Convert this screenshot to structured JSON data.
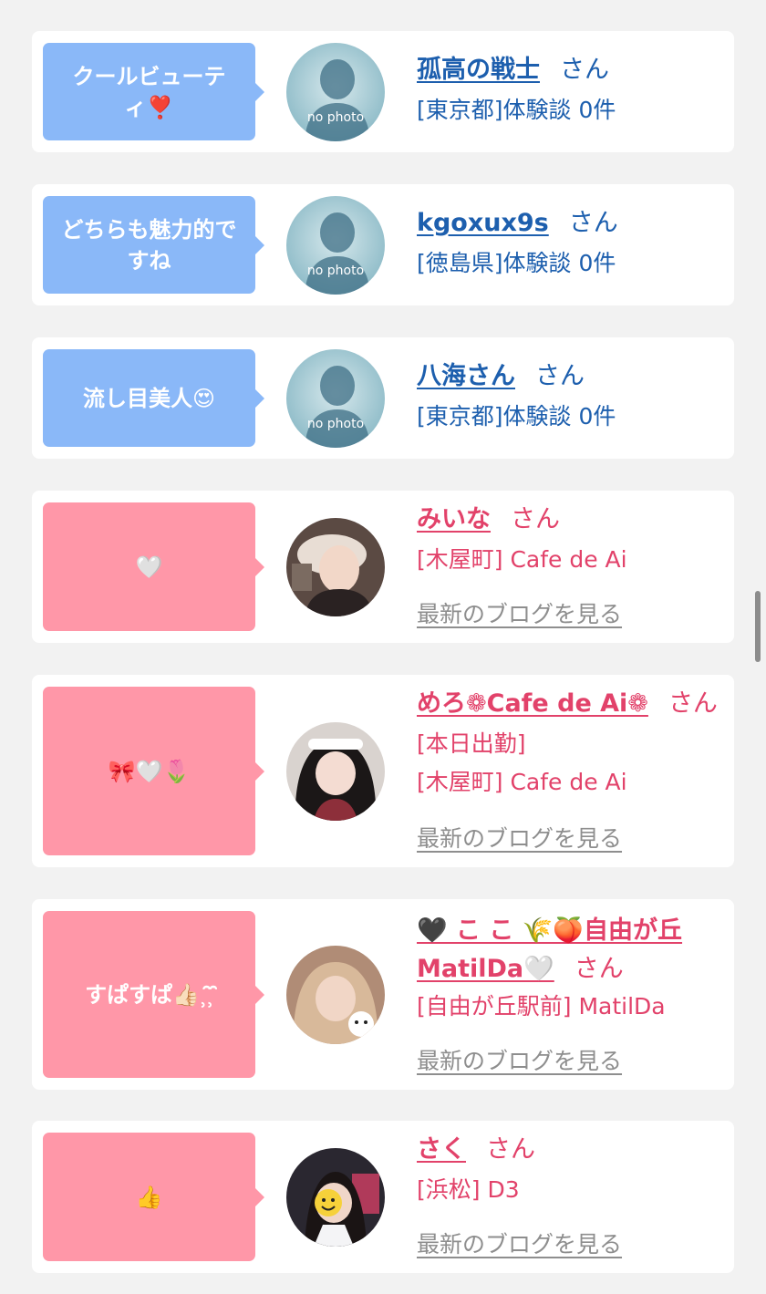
{
  "entries": [
    {
      "bubble": "クールビューティ❣️",
      "name": "孤高の戦士",
      "suffix": "さん",
      "meta": "[東京都]体験談 0件",
      "avatar": "no photo"
    },
    {
      "bubble": "どちらも魅力的ですね",
      "name": "kgoxux9s",
      "suffix": "さん",
      "meta": "[徳島県]体験談 0件",
      "avatar": "no photo"
    },
    {
      "bubble": "流し目美人😍",
      "name": "八海さん",
      "suffix": "さん",
      "meta": "[東京都]体験談 0件",
      "avatar": "no photo"
    },
    {
      "bubble": "🤍",
      "name": "みいな",
      "suffix": "さん",
      "meta": "[木屋町] Cafe de Ai",
      "blog": "最新のブログを見る"
    },
    {
      "bubble": "🎀🤍🌷",
      "name": "めろ❁Cafe de Ai❁",
      "suffix": "さん",
      "status": "[本日出勤]",
      "meta": "[木屋町] Cafe de Ai",
      "blog": "最新のブログを見る"
    },
    {
      "bubble": "すぱすぱ👍🏻⸒̑⸒̑",
      "name": "🖤 こ こ 🌾🍑自由が丘MatilDa🤍",
      "suffix": "さん",
      "meta": "[自由が丘駅前] MatilDa",
      "blog": "最新のブログを見る"
    },
    {
      "bubble": "👍",
      "name": "さく",
      "suffix": "さん",
      "meta": "[浜松] D3",
      "blog": "最新のブログを見る"
    }
  ]
}
